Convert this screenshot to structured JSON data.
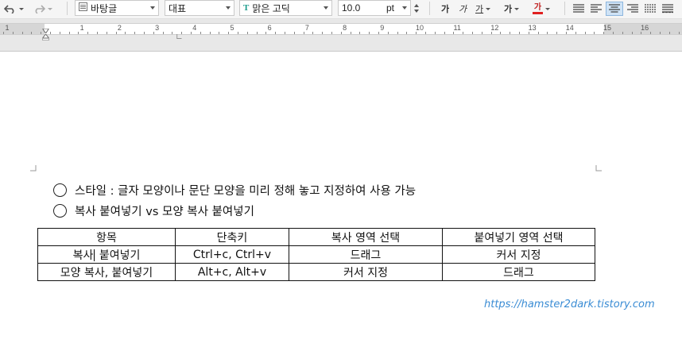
{
  "toolbar": {
    "style_name": "바탕글",
    "font_lang": "대표",
    "font_name": "맑은 고딕",
    "font_size": "10.0",
    "font_unit": "pt",
    "bold_label": "가",
    "italic_label": "가",
    "underline_label": "가",
    "strike_label": "가",
    "color_label": "가",
    "color_accent": "#e02020"
  },
  "ruler": {
    "numbers": [
      "1",
      "1",
      "2",
      "3",
      "4",
      "5",
      "6",
      "7",
      "8",
      "9",
      "10",
      "11",
      "12",
      "13",
      "14",
      "15",
      "16"
    ]
  },
  "document": {
    "line1": "스타일 : 글자 모양이나 문단 모양을 미리 정해 놓고 지정하여 사용 가능",
    "line2": "복사 붙여넣기 vs 모양 복사 붙여넣기",
    "table": {
      "headers": [
        "항목",
        "단축키",
        "복사 영역 선택",
        "붙여넣기 영역 선택"
      ],
      "rows": [
        [
          "복사 붙여넣기",
          "Ctrl+c, Ctrl+v",
          "드래그",
          "커서 지정"
        ],
        [
          "모양 복사, 붙여넣기",
          "Alt+c, Alt+v",
          "커서 지정",
          "드래그"
        ]
      ],
      "row1_first_a": "복사",
      "row1_first_b": " 붙여넣기"
    },
    "watermark": "https://hamster2dark.tistory.com"
  }
}
